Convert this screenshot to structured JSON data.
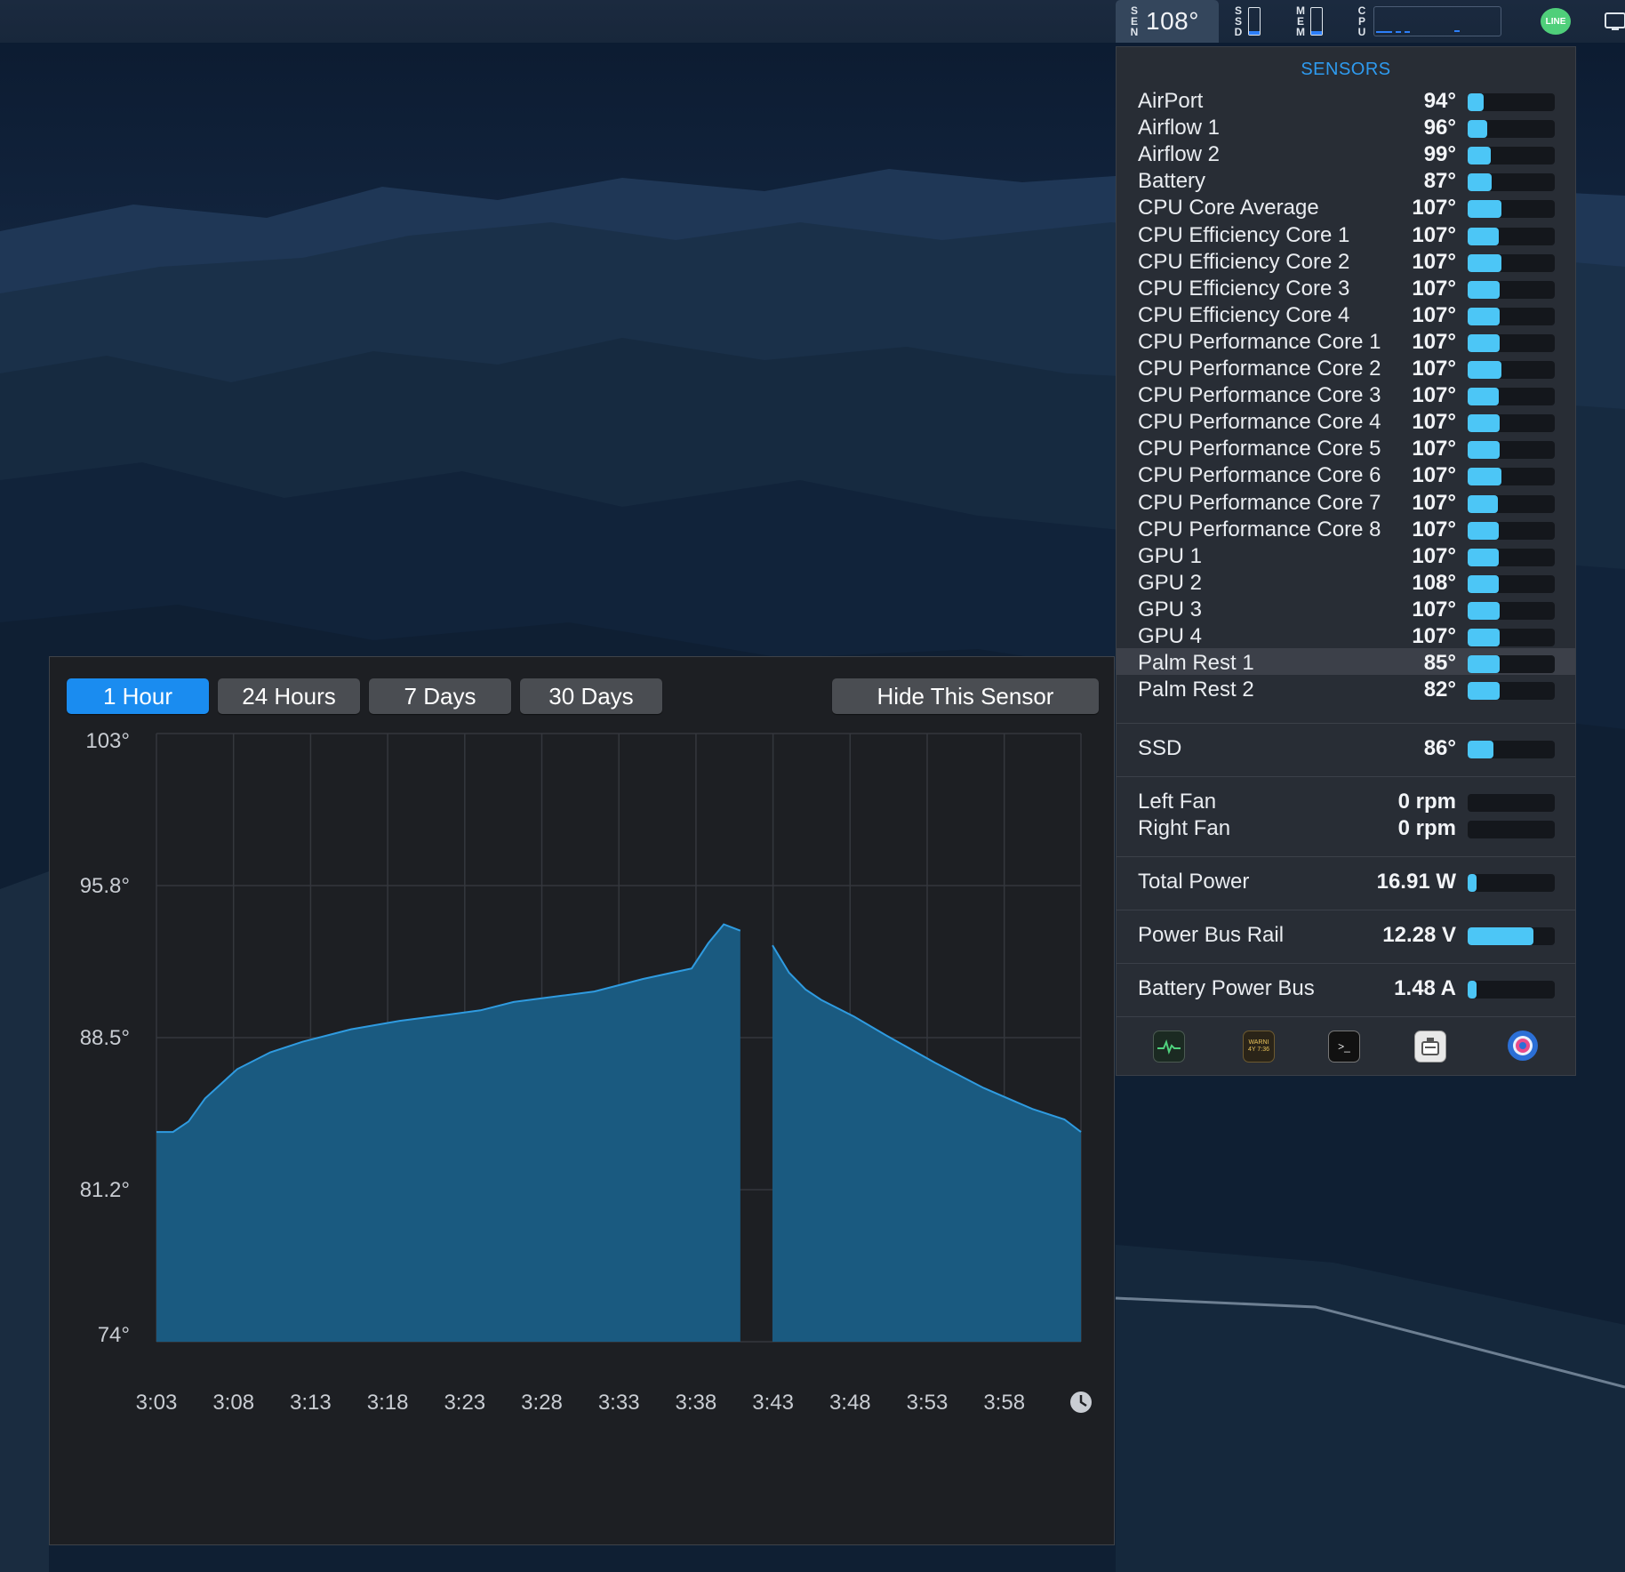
{
  "menubar": {
    "sen_label": "SEN",
    "sen_value": "108°",
    "ssd_label": "SSD",
    "mem_label": "MEM",
    "cpu_label": "CPU",
    "ssd_fill_fraction": 0.15,
    "mem_fill_fraction": 0.12,
    "line_icon_text": "LINE"
  },
  "panel": {
    "title": "SENSORS",
    "temperatures": [
      {
        "name": "AirPort",
        "value": "94°",
        "fraction": 0.18
      },
      {
        "name": "Airflow 1",
        "value": "96°",
        "fraction": 0.22
      },
      {
        "name": "Airflow 2",
        "value": "99°",
        "fraction": 0.27
      },
      {
        "name": "Battery",
        "value": "87°",
        "fraction": 0.28
      },
      {
        "name": "CPU Core Average",
        "value": "107°",
        "fraction": 0.39
      },
      {
        "name": "CPU Efficiency Core 1",
        "value": "107°",
        "fraction": 0.36
      },
      {
        "name": "CPU Efficiency Core 2",
        "value": "107°",
        "fraction": 0.39
      },
      {
        "name": "CPU Efficiency Core 3",
        "value": "107°",
        "fraction": 0.37
      },
      {
        "name": "CPU Efficiency Core 4",
        "value": "107°",
        "fraction": 0.37
      },
      {
        "name": "CPU Performance Core 1",
        "value": "107°",
        "fraction": 0.37
      },
      {
        "name": "CPU Performance Core 2",
        "value": "107°",
        "fraction": 0.39
      },
      {
        "name": "CPU Performance Core 3",
        "value": "107°",
        "fraction": 0.36
      },
      {
        "name": "CPU Performance Core 4",
        "value": "107°",
        "fraction": 0.37
      },
      {
        "name": "CPU Performance Core 5",
        "value": "107°",
        "fraction": 0.37
      },
      {
        "name": "CPU Performance Core 6",
        "value": "107°",
        "fraction": 0.39
      },
      {
        "name": "CPU Performance Core 7",
        "value": "107°",
        "fraction": 0.35
      },
      {
        "name": "CPU Performance Core 8",
        "value": "107°",
        "fraction": 0.36
      },
      {
        "name": "GPU 1",
        "value": "107°",
        "fraction": 0.36
      },
      {
        "name": "GPU 2",
        "value": "108°",
        "fraction": 0.36
      },
      {
        "name": "GPU 3",
        "value": "107°",
        "fraction": 0.37
      },
      {
        "name": "GPU 4",
        "value": "107°",
        "fraction": 0.37
      },
      {
        "name": "Palm Rest 1",
        "value": "85°",
        "fraction": 0.37,
        "highlighted": true
      },
      {
        "name": "Palm Rest 2",
        "value": "82°",
        "fraction": 0.37
      }
    ],
    "ssd": {
      "name": "SSD",
      "value": "86°",
      "fraction": 0.3
    },
    "fans": [
      {
        "name": "Left Fan",
        "value": "0 rpm",
        "fraction": 0
      },
      {
        "name": "Right Fan",
        "value": "0 rpm",
        "fraction": 0
      }
    ],
    "power": {
      "name": "Total Power",
      "value": "16.91 W",
      "fraction": 0.1
    },
    "voltage": {
      "name": "Power Bus Rail",
      "value": "12.28 V",
      "fraction": 0.76
    },
    "current": {
      "name": "Battery Power Bus",
      "value": "1.48 A",
      "fraction": 0.1
    },
    "footer_apps": [
      "activity-monitor-icon",
      "console-icon",
      "terminal-icon",
      "system-information-icon",
      "disk-utility-icon"
    ],
    "console_icon_text": "WARNI\n4Y 7:36",
    "terminal_icon_text": ">_"
  },
  "history": {
    "buttons": {
      "one_hour": "1 Hour",
      "twenty_four": "24 Hours",
      "seven_days": "7 Days",
      "thirty_days": "30 Days",
      "hide": "Hide This Sensor"
    },
    "active_range": "1 Hour"
  },
  "chart_data": {
    "type": "area",
    "title": "",
    "xlabel": "",
    "ylabel": "",
    "ylim": [
      74,
      103
    ],
    "y_ticks": [
      "103°",
      "95.8°",
      "88.5°",
      "81.2°",
      "74°"
    ],
    "x_ticks": [
      "3:03",
      "3:08",
      "3:13",
      "3:18",
      "3:23",
      "3:28",
      "3:33",
      "3:38",
      "3:43",
      "3:48",
      "3:53",
      "3:58"
    ],
    "grid": true,
    "color": "#1a5a80",
    "line_color": "#2f9be0",
    "series": [
      {
        "x": [
          3.05,
          3.067,
          3.083,
          3.1,
          3.133,
          3.167,
          3.2,
          3.25,
          3.3,
          3.35,
          3.383,
          3.417,
          3.467,
          3.5,
          3.55,
          3.6,
          3.617,
          3.633,
          3.65
        ],
        "y": [
          84.0,
          84.0,
          84.5,
          85.6,
          87.0,
          87.8,
          88.3,
          88.9,
          89.3,
          89.6,
          89.8,
          90.2,
          90.5,
          90.7,
          91.3,
          91.8,
          93.0,
          93.9,
          93.6
        ]
      },
      {
        "x": [
          3.683,
          3.7,
          3.717,
          3.733,
          3.767,
          3.8,
          3.85,
          3.9,
          3.95,
          3.983,
          4.0
        ],
        "y": [
          92.9,
          91.6,
          90.8,
          90.3,
          89.5,
          88.6,
          87.3,
          86.1,
          85.1,
          84.6,
          84.0
        ]
      }
    ]
  }
}
